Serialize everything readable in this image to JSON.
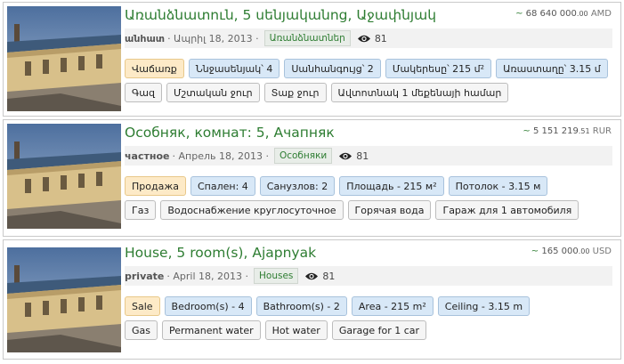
{
  "colors": {
    "title": "#2e7d32",
    "sale_tag_bg": "#fdeac7",
    "feature_tag_bg": "#d8e8f7",
    "amenity_tag_bg": "#f5f5f5"
  },
  "listings": [
    {
      "title": "Առանձնատուն, 5 սենյականոց, Աջափնյակ",
      "price_main": "68 640 000",
      "price_cents": ".00",
      "currency": "AMD",
      "price_icon": "trend-arrow-icon",
      "type": "անհատ",
      "date": "· Ապրիլ 18, 2013 ·",
      "category": "Առանձնատներ",
      "views": "81",
      "tags_row1": [
        {
          "label": "Վաճառք",
          "kind": "sale"
        },
        {
          "label": "Ննջասենյակ՝ 4",
          "kind": "blue"
        },
        {
          "label": "Սանհանգույց՝ 2",
          "kind": "blue"
        },
        {
          "label": "Մակերեսը՝ 215 մ²",
          "kind": "blue"
        },
        {
          "label": "Առաստաղը՝ 3.15 մ",
          "kind": "blue"
        }
      ],
      "tags_row2": [
        {
          "label": "Գազ",
          "kind": "grey"
        },
        {
          "label": "Մշտական ջուր",
          "kind": "grey"
        },
        {
          "label": "Տաք ջուր",
          "kind": "grey"
        },
        {
          "label": "Ավտոտնակ 1 մեքենայի համար",
          "kind": "grey"
        }
      ]
    },
    {
      "title": "Особняк, комнат: 5, Ачапняк",
      "price_main": "5 151 219",
      "price_cents": ".51",
      "currency": "RUR",
      "price_icon": "trend-arrow-icon",
      "type": "частное",
      "date": "· Апрель 18, 2013 ·",
      "category": "Особняки",
      "views": "81",
      "tags_row1": [
        {
          "label": "Продажа",
          "kind": "sale"
        },
        {
          "label": "Спален: 4",
          "kind": "blue"
        },
        {
          "label": "Санузлов: 2",
          "kind": "blue"
        },
        {
          "label": "Площадь - 215 м²",
          "kind": "blue"
        },
        {
          "label": "Потолок - 3.15 м",
          "kind": "blue"
        }
      ],
      "tags_row2": [
        {
          "label": "Газ",
          "kind": "grey"
        },
        {
          "label": "Водоснабжение круглосуточное",
          "kind": "grey"
        },
        {
          "label": "Горячая вода",
          "kind": "grey"
        },
        {
          "label": "Гараж для 1 автомобиля",
          "kind": "grey"
        }
      ]
    },
    {
      "title": "House, 5 room(s), Ajapnyak",
      "price_main": "165 000",
      "price_cents": ".00",
      "currency": "USD",
      "price_icon": "trend-arrow-icon",
      "type": "private",
      "date": "· April 18, 2013 ·",
      "category": "Houses",
      "views": "81",
      "tags_row1": [
        {
          "label": "Sale",
          "kind": "sale"
        },
        {
          "label": "Bedroom(s) - 4",
          "kind": "blue"
        },
        {
          "label": "Bathroom(s) - 2",
          "kind": "blue"
        },
        {
          "label": "Area - 215 m²",
          "kind": "blue"
        },
        {
          "label": "Ceiling - 3.15 m",
          "kind": "blue"
        }
      ],
      "tags_row2": [
        {
          "label": "Gas",
          "kind": "grey"
        },
        {
          "label": "Permanent water",
          "kind": "grey"
        },
        {
          "label": "Hot water",
          "kind": "grey"
        },
        {
          "label": "Garage for 1 car",
          "kind": "grey"
        }
      ]
    }
  ]
}
